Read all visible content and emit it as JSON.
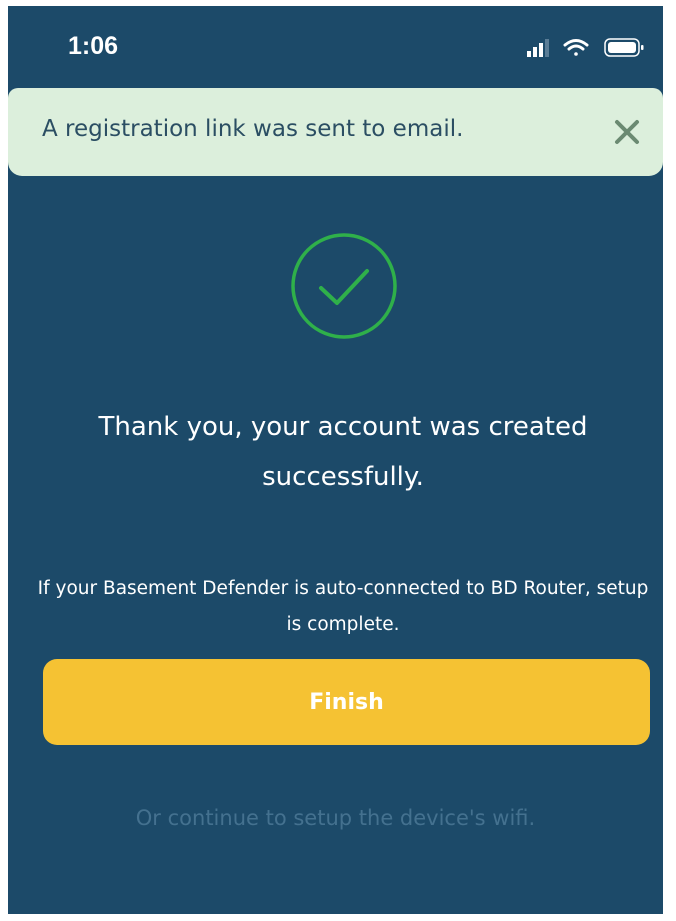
{
  "status_bar": {
    "time": "1:06"
  },
  "toast": {
    "message": "A registration link was sent to email.",
    "close_icon": "close-icon"
  },
  "success": {
    "icon": "checkmark-circle-icon",
    "color": "#2fb04a"
  },
  "main": {
    "title": "Thank you, your account was created successfully.",
    "note": "If your Basement Defender is auto-connected to BD Router, setup is complete."
  },
  "actions": {
    "finish_label": "Finish",
    "wifi_link": "Or continue to setup the device's wifi."
  },
  "colors": {
    "background": "#1c4a69",
    "toast_background": "#dcefdc",
    "button": "#f5c233",
    "link": "#44718f"
  }
}
